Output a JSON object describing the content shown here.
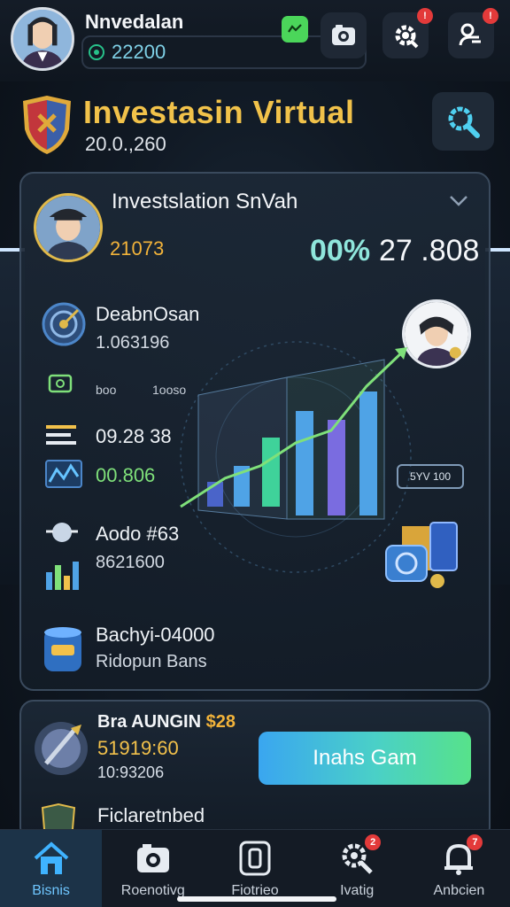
{
  "header": {
    "user_name": "Nnvedalan",
    "balance": "22200",
    "icons": [
      "coin-icon",
      "chat-icon",
      "camera-icon",
      "settings-icon",
      "profile-icon"
    ],
    "settings_badge": "!",
    "profile_badge": "!"
  },
  "title": {
    "main": "Investasin Virtual",
    "sub": "20.0.,260"
  },
  "card": {
    "title": "Investslation SnVah",
    "left_value": "21073",
    "percent": "00%",
    "right_value": "27 .808",
    "metrics": [
      {
        "label": "DeabnOsan",
        "value": "1.063196"
      },
      {
        "label": "boo",
        "value": "1ooso"
      },
      {
        "label": "09.28 38"
      },
      {
        "label": "00.806"
      },
      {
        "label": "Aodo #63",
        "value": "8621600"
      },
      {
        "label": "Bachyi-04000",
        "value": "Ridopun Bans"
      }
    ],
    "chip": "5YV 100"
  },
  "card2": {
    "title": "Bra AUNGIN",
    "title_highlight": "$28",
    "value1": "51919:60",
    "value2": "10:93206",
    "footer": "Ficlaretnbed",
    "cta_label": "Inahs Gam"
  },
  "nav": [
    {
      "label": "Bisnis",
      "icon": "home-icon",
      "badge": ""
    },
    {
      "label": "Roenotivg",
      "icon": "camera-icon",
      "badge": ""
    },
    {
      "label": "Fiotrieo",
      "icon": "document-icon",
      "badge": ""
    },
    {
      "label": "Ivatig",
      "icon": "search-icon",
      "badge": "2"
    },
    {
      "label": "Anbcien",
      "icon": "bell-icon",
      "badge": "7"
    }
  ],
  "colors": {
    "accent_gold": "#f1c24a",
    "accent_teal": "#8fe6dc",
    "cta_start": "#3aa6f0",
    "cta_end": "#57e28a",
    "badge_red": "#e33a3a"
  }
}
